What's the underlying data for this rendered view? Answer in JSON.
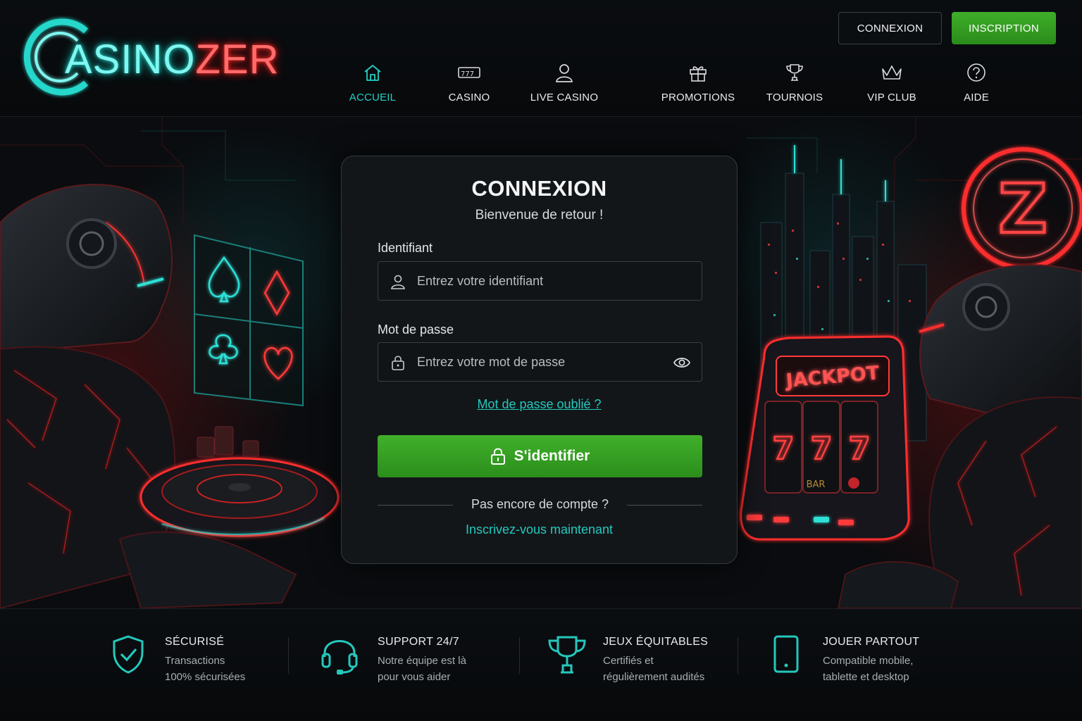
{
  "brand": {
    "logo_part1": "ASINO",
    "logo_part2": "ZER",
    "logo_initial": "C"
  },
  "header": {
    "login_label": "CONNEXION",
    "signup_label": "INSCRIPTION"
  },
  "nav": {
    "items": [
      {
        "label": "ACCUEIL",
        "icon": "home-icon",
        "active": true
      },
      {
        "label": "CASINO",
        "icon": "slot-777-icon"
      },
      {
        "label": "LIVE CASINO",
        "icon": "user-icon"
      },
      {
        "label": "PROMOTIONS",
        "icon": "gift-icon"
      },
      {
        "label": "TOURNOIS",
        "icon": "trophy-icon"
      },
      {
        "label": "VIP CLUB",
        "icon": "crown-icon"
      },
      {
        "label": "AIDE",
        "icon": "question-icon"
      }
    ]
  },
  "login": {
    "title": "CONNEXION",
    "subtitle": "Bienvenue de retour !",
    "username_label": "Identifiant",
    "username_placeholder": "Entrez votre identifiant",
    "password_label": "Mot de passe",
    "password_placeholder": "Entrez votre mot de passe",
    "forgot_link": "Mot de passe oublié ?",
    "submit_label": "S'identifier",
    "no_account": "Pas encore de compte ?",
    "signup_link": "Inscrivez-vous maintenant"
  },
  "hero": {
    "jackpot_sign": "JACKPOT",
    "reel_symbols": [
      "7",
      "7",
      "7"
    ],
    "reel_bar": "BAR",
    "emblem_letter": "Z"
  },
  "features": [
    {
      "title": "SÉCURISÉ",
      "desc": "Transactions\n100% sécurisées",
      "icon": "shield-check-icon"
    },
    {
      "title": "SUPPORT 24/7",
      "desc": "Notre équipe est là\npour vous aider",
      "icon": "headset-icon"
    },
    {
      "title": "JEUX ÉQUITABLES",
      "desc": "Certifiés et\nrégulièrement audités",
      "icon": "trophy-icon"
    },
    {
      "title": "JOUER PARTOUT",
      "desc": "Compatible mobile,\ntablette et desktop",
      "icon": "mobile-icon"
    }
  ],
  "colors": {
    "accent_teal": "#25d0c4",
    "accent_green": "#3a9f25",
    "neon_red": "#ff3030",
    "background": "#07090b"
  }
}
